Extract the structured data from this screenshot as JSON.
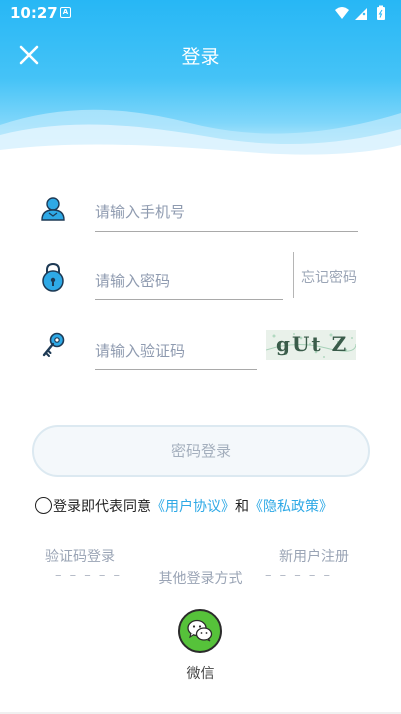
{
  "status": {
    "time": "10:27",
    "notification_glyph": "A"
  },
  "header": {
    "title": "登录"
  },
  "form": {
    "phone_placeholder": "请输入手机号",
    "password_placeholder": "请输入密码",
    "forgot_label": "忘记密码",
    "code_placeholder": "请输入验证码",
    "captcha_text": "gUt Z"
  },
  "login_button": "密码登录",
  "agreement": {
    "prefix": "登录即代表同意",
    "user_agreement": "《用户协议》",
    "and": "和",
    "privacy_policy": "《隐私政策》"
  },
  "links": {
    "sms_login": "验证码登录",
    "register": "新用户注册"
  },
  "other_login": {
    "label": "其他登录方式",
    "dashes_left": "– – – – –",
    "dashes_right": "– – – – –"
  },
  "wechat": {
    "label": "微信"
  },
  "colors": {
    "accent": "#2ea9e6",
    "header": "#27b7f5",
    "wechat": "#56c23a"
  }
}
